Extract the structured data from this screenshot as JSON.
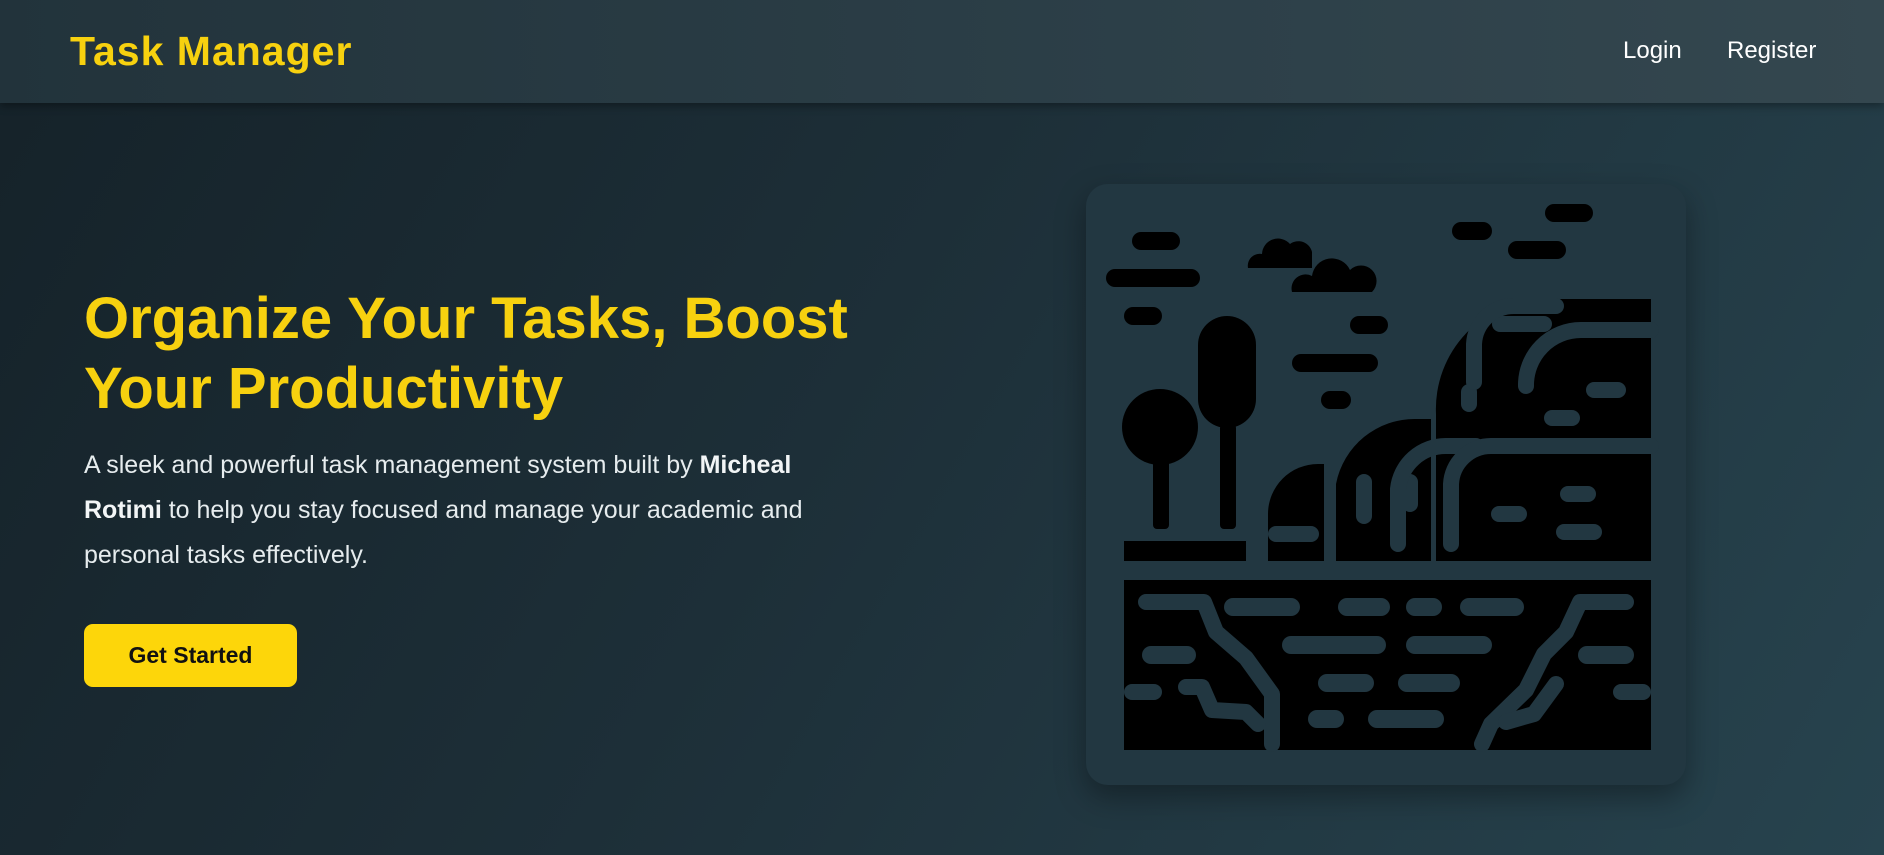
{
  "navbar": {
    "brand": "Task Manager",
    "links": [
      {
        "label": "Login"
      },
      {
        "label": "Register"
      }
    ]
  },
  "hero": {
    "title": "Organize Your Tasks, Boost Your Productivity",
    "description": {
      "prefix": "A sleek and powerful task management system built by ",
      "author": "Micheal Rotimi",
      "suffix": " to help you stay focused and manage your academic and personal tasks effectively."
    },
    "cta_label": "Get Started"
  },
  "illustration": {
    "icon": "landscape-illustration-icon"
  },
  "colors": {
    "accent": "#f7d10f",
    "button": "#fdd60a",
    "card": "#223741"
  }
}
